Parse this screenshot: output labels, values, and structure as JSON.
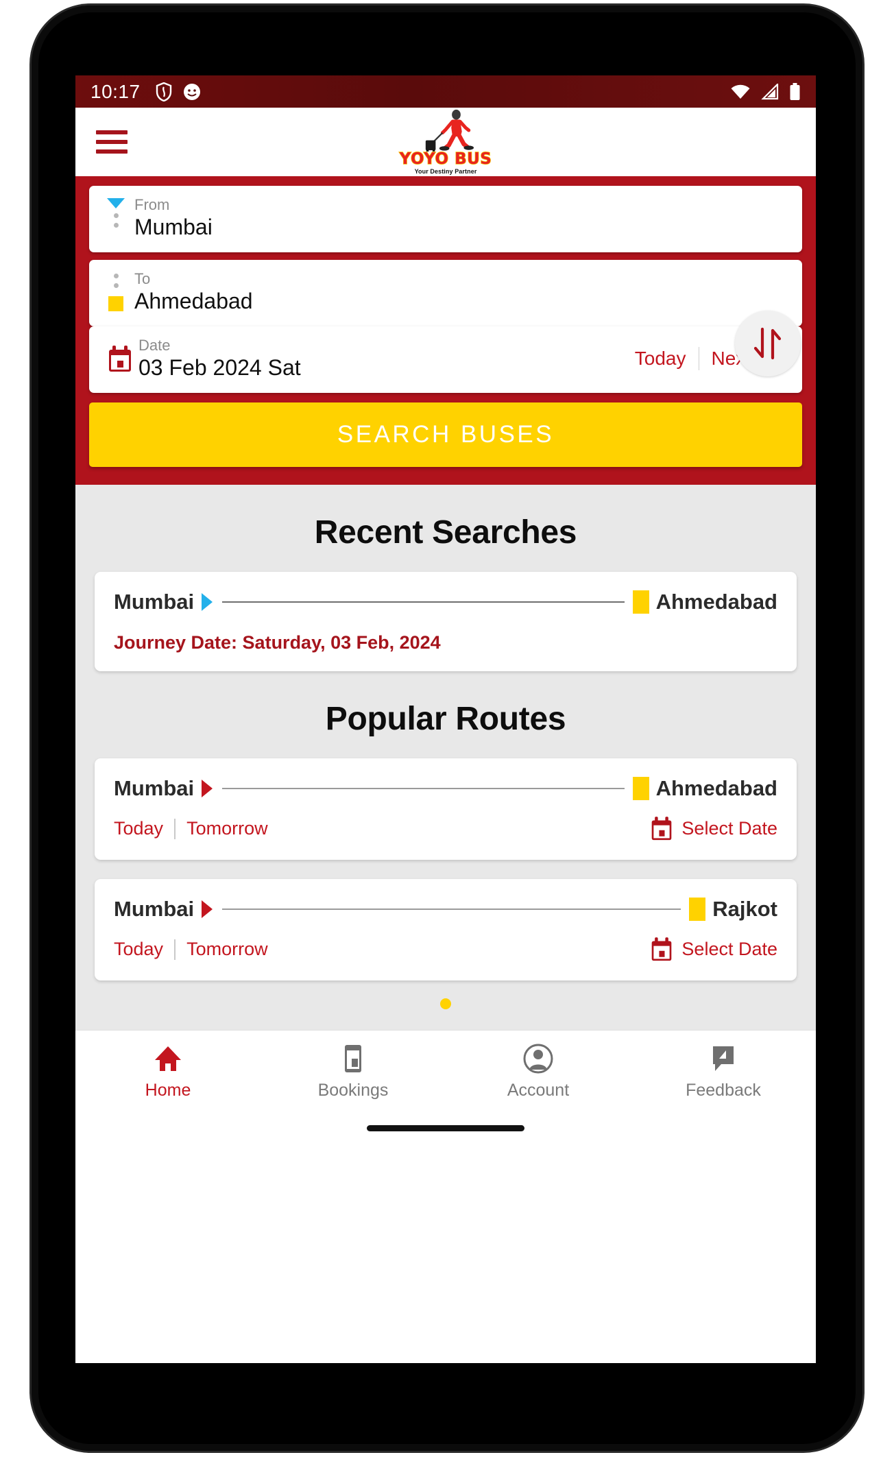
{
  "status_bar": {
    "time": "10:17",
    "left_icons": [
      "shield-icon",
      "app-notification-icon"
    ],
    "right_icons": [
      "wifi-icon",
      "cellular-signal-icon",
      "battery-icon"
    ],
    "background_color": "#5a0b0b"
  },
  "header": {
    "menu_icon": "hamburger-menu-icon",
    "brand_name": "YOYO BUS",
    "brand_tagline": "Your Destiny Partner"
  },
  "search_panel": {
    "background_color": "#b0131c",
    "from": {
      "label": "From",
      "value": "Mumbai",
      "marker": "cyan-triangle-down"
    },
    "to": {
      "label": "To",
      "value": "Ahmedabad",
      "marker": "yellow-square"
    },
    "swap_icon": "swap-arrows-icon",
    "date": {
      "label": "Date",
      "value": "03 Feb 2024 Sat",
      "icon": "calendar-icon",
      "today_label": "Today",
      "next_day_label": "Next day"
    },
    "search_button_label": "SEARCH BUSES",
    "search_button_color": "#ffd200"
  },
  "recent_searches": {
    "title": "Recent Searches",
    "items": [
      {
        "origin": "Mumbai",
        "destination": "Ahmedabad",
        "journey_date": "Journey Date: Saturday, 03 Feb, 2024",
        "arrow_color": "#23b0ea"
      }
    ]
  },
  "popular_routes": {
    "title": "Popular Routes",
    "items": [
      {
        "origin": "Mumbai",
        "destination": "Ahmedabad",
        "today_label": "Today",
        "tomorrow_label": "Tomorrow",
        "select_date_label": "Select Date",
        "arrow_color": "#c3161f"
      },
      {
        "origin": "Mumbai",
        "destination": "Rajkot",
        "today_label": "Today",
        "tomorrow_label": "Tomorrow",
        "select_date_label": "Select Date",
        "arrow_color": "#c3161f"
      }
    ],
    "page_indicator_count": 1
  },
  "bottom_nav": {
    "items": [
      {
        "label": "Home",
        "icon": "home-icon",
        "active": true
      },
      {
        "label": "Bookings",
        "icon": "ticket-icon",
        "active": false
      },
      {
        "label": "Account",
        "icon": "user-circle-icon",
        "active": false
      },
      {
        "label": "Feedback",
        "icon": "feedback-chat-icon",
        "active": false
      }
    ],
    "active_color": "#c3161f",
    "inactive_color": "#7a7a7a"
  }
}
